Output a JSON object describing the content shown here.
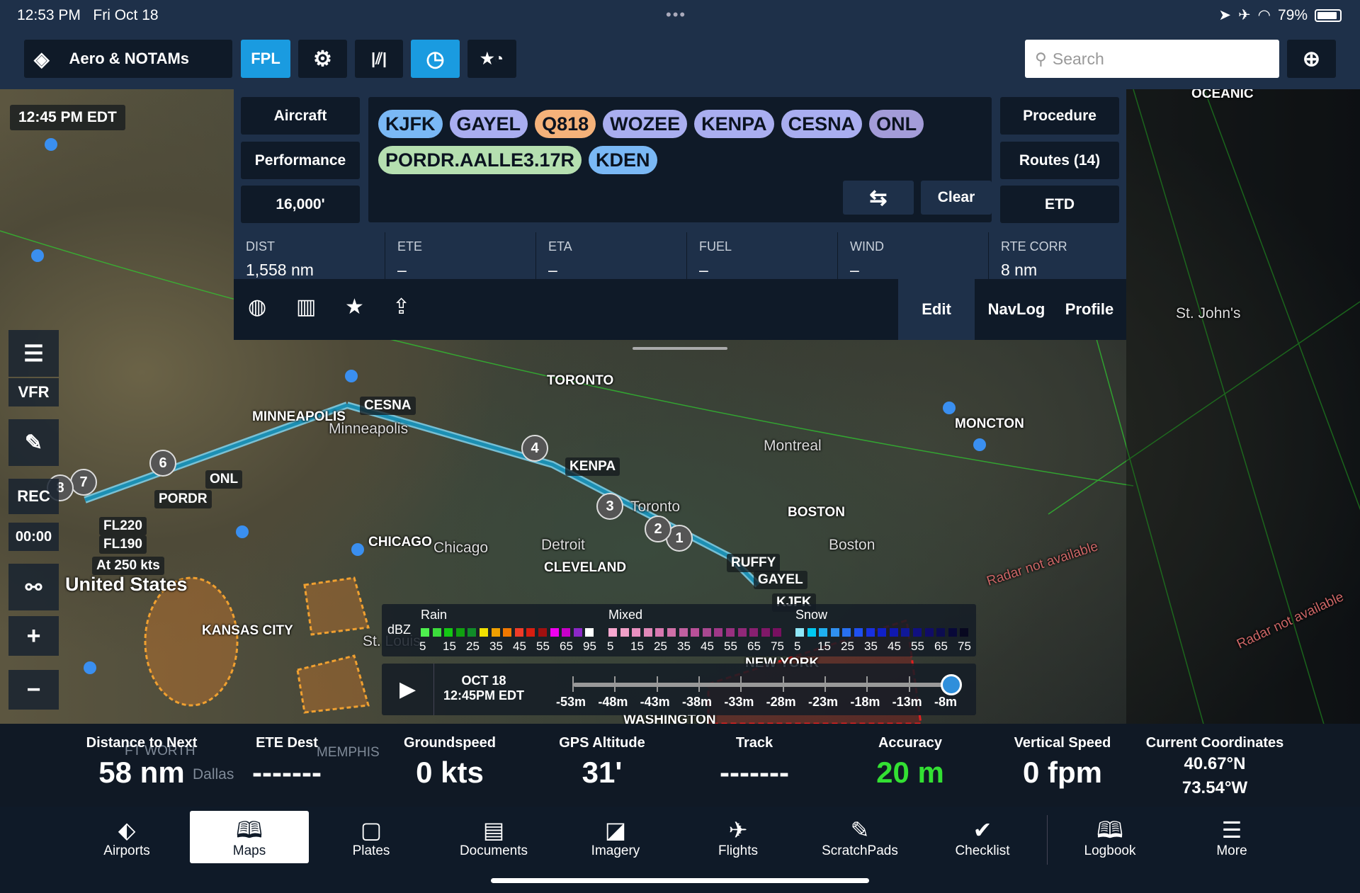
{
  "status": {
    "time": "12:53 PM",
    "date": "Fri Oct 18",
    "battery": "79%"
  },
  "toolbar": {
    "layers_label": "Aero & NOTAMs",
    "fpl": "FPL",
    "search_placeholder": "Search"
  },
  "fpl": {
    "left_buttons": [
      "Aircraft",
      "Performance",
      "16,000'"
    ],
    "right_buttons": [
      "Procedure",
      "Routes (14)",
      "ETD"
    ],
    "chips": [
      {
        "label": "KJFK",
        "color": "#7ab8f5"
      },
      {
        "label": "GAYEL",
        "color": "#a9aef0"
      },
      {
        "label": "Q818",
        "color": "#f5b27a"
      },
      {
        "label": "WOZEE",
        "color": "#a9aef0"
      },
      {
        "label": "KENPA",
        "color": "#a9aef0"
      },
      {
        "label": "CESNA",
        "color": "#a9aef0"
      },
      {
        "label": "ONL",
        "color": "#a39cd8"
      },
      {
        "label": "PORDR.AALLE3.17R",
        "color": "#b5dfb0"
      },
      {
        "label": "KDEN",
        "color": "#7ab8f5"
      }
    ],
    "clear": "Clear",
    "stats": [
      {
        "k": "DIST",
        "v": "1,558 nm"
      },
      {
        "k": "ETE",
        "v": "–"
      },
      {
        "k": "ETA",
        "v": "–"
      },
      {
        "k": "FUEL",
        "v": "–"
      },
      {
        "k": "WIND",
        "v": "–"
      },
      {
        "k": "RTE CORR",
        "v": "8 nm"
      }
    ],
    "edit": "Edit",
    "navlog": "NavLog",
    "profile": "Profile"
  },
  "map": {
    "radar_time": "12:45 PM EDT",
    "labels": [
      "TORONTO",
      "MINNEAPOLIS",
      "Minneapolis",
      "Montreal",
      "MONCTON",
      "St. John's",
      "BOSTON",
      "Boston",
      "CHICAGO",
      "Chicago",
      "Detroit",
      "CLEVELAND",
      "Toronto",
      "KANSAS CITY",
      "St. Louis",
      "NEW YORK",
      "WASHINGTON",
      "United States",
      "OCEANIC",
      "MEMPHIS",
      "Dallas",
      "FT WORTH"
    ],
    "waypoints": [
      "CESNA",
      "KENPA",
      "ONL",
      "PORDR",
      "GAYEL",
      "RUFFY",
      "KJFK"
    ],
    "leg_numbers": [
      "1",
      "2",
      "3",
      "4",
      "6",
      "7",
      "8"
    ],
    "altitudes": [
      "FL220",
      "FL190",
      "At 250 kts"
    ],
    "radar_na": "Radar not available",
    "side": {
      "vfr": "VFR",
      "rec": "REC",
      "timer": "00:00"
    }
  },
  "legend": {
    "unit": "dBZ",
    "rain": "Rain",
    "mixed": "Mixed",
    "snow": "Snow",
    "rain_ticks": [
      "5",
      "15",
      "25",
      "35",
      "45",
      "55",
      "65",
      "95"
    ],
    "mixed_ticks": [
      "5",
      "15",
      "25",
      "35",
      "45",
      "55",
      "65",
      "75"
    ],
    "snow_ticks": [
      "5",
      "15",
      "25",
      "35",
      "45",
      "55",
      "65",
      "75"
    ],
    "rain_colors": [
      "#4ef04e",
      "#3cdc3c",
      "#14c814",
      "#10a010",
      "#108c28",
      "#f0e000",
      "#f0a000",
      "#f07800",
      "#f03c28",
      "#d81e10",
      "#a01010",
      "#f000f0",
      "#c800c8",
      "#8c28c8",
      "#ffffff"
    ],
    "mixed_colors": [
      "#f8a8d0",
      "#f0a0c8",
      "#e890c0",
      "#e088b8",
      "#d878b0",
      "#d070a8",
      "#c060a0",
      "#b85098",
      "#a84890",
      "#a03888",
      "#983080",
      "#902878",
      "#882070",
      "#801868",
      "#781060"
    ],
    "snow_colors": [
      "#90e8f8",
      "#00c8f0",
      "#20b0f0",
      "#3090f0",
      "#2870f0",
      "#2050f0",
      "#1830e0",
      "#1020c8",
      "#1018b0",
      "#101898",
      "#101080",
      "#100c68",
      "#0c0c50",
      "#080838",
      "#080820"
    ]
  },
  "timeline": {
    "date": "OCT 18",
    "time": "12:45PM EDT",
    "ticks": [
      "-53m",
      "-48m",
      "-43m",
      "-38m",
      "-33m",
      "-28m",
      "-23m",
      "-18m",
      "-13m",
      "-8m"
    ],
    "position": 1.0
  },
  "info": [
    {
      "k": "Distance to Next",
      "v": "58 nm"
    },
    {
      "k": "ETE Dest",
      "v": "-------"
    },
    {
      "k": "Groundspeed",
      "v": "0 kts"
    },
    {
      "k": "GPS Altitude",
      "v": "31'"
    },
    {
      "k": "Track",
      "v": "-------"
    },
    {
      "k": "Accuracy",
      "v": "20 m",
      "color": "#33e033"
    },
    {
      "k": "Vertical Speed",
      "v": "0 fpm"
    },
    {
      "k": "Current Coordinates",
      "v": "40.67°N",
      "v2": "73.54°W"
    }
  ],
  "tabs": [
    {
      "label": "Airports",
      "icon": "⬖"
    },
    {
      "label": "Maps",
      "icon": "🕮"
    },
    {
      "label": "Plates",
      "icon": "▢"
    },
    {
      "label": "Documents",
      "icon": "▤"
    },
    {
      "label": "Imagery",
      "icon": "◪"
    },
    {
      "label": "Flights",
      "icon": "✈"
    },
    {
      "label": "ScratchPads",
      "icon": "✎"
    },
    {
      "label": "Checklist",
      "icon": "✔"
    },
    {
      "label": "Logbook",
      "icon": "🕮"
    },
    {
      "label": "More",
      "icon": "☰"
    }
  ],
  "selected_tab": "Maps"
}
